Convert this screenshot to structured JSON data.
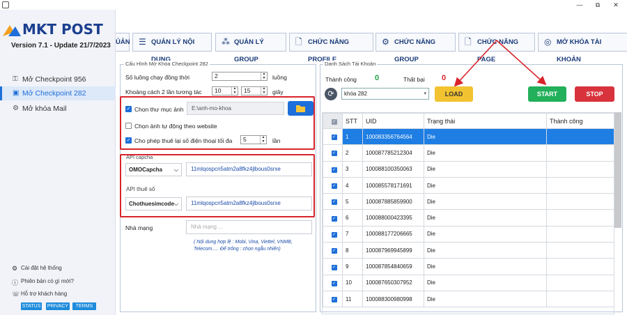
{
  "window": {
    "minimize": "—",
    "restore": "⧉",
    "close": "✕"
  },
  "brand": {
    "logo_text": "MKT POST",
    "version": "Version  7.1  - Update  21/7/2023"
  },
  "sidebar": {
    "items": [
      {
        "label": "Mở Checkpoint 956",
        "active": false
      },
      {
        "label": "Mở Checkpoint 282",
        "active": true
      },
      {
        "label": "Mở khóa Mail",
        "active": false
      }
    ],
    "bottom": [
      {
        "label": "Cài đặt hệ thống"
      },
      {
        "label": "Phiên bản có gì mới?"
      },
      {
        "label": "Hỗ trợ khách hàng"
      }
    ],
    "pills": [
      "STATUS",
      "PRIVACY",
      "TERMS"
    ]
  },
  "tabs": [
    {
      "label": "ỦẢN"
    },
    {
      "label": "QUẢN LÝ NỘI DUNG"
    },
    {
      "label": "QUẢN LÝ GROUP"
    },
    {
      "label": "CHỨC NĂNG PROFILE"
    },
    {
      "label": "CHỨC NĂNG GROUP"
    },
    {
      "label": "CHỨC NĂNG PAGE"
    },
    {
      "label": "MỞ KHÓA TÀI KHOẢN"
    }
  ],
  "config": {
    "legend": "Cấu Hình Mở Khóa Checkpoint 282",
    "threads_label": "Số luồng chạy đồng thời",
    "threads_value": "2",
    "threads_unit": "luồng",
    "interval_label": "Khoảng cách 2 lần tương tác",
    "interval_from": "10",
    "interval_to": "15",
    "interval_unit": "giây",
    "image_folder_label": "Chọn  thư mục ảnh",
    "image_folder_value": "E:\\anh-mo-khoa",
    "image_folder_checked": true,
    "auto_image_label": "Chọn ảnh tự động theo website",
    "auto_image_checked": false,
    "retry_label": "Cho phép thuê lại số điện thoại tối đa",
    "retry_value": "5",
    "retry_unit": "lần",
    "retry_checked": true,
    "captcha_legend": "API capcha",
    "captcha_provider": "OMOCapcha",
    "captcha_key": "11mlqospcn5atm2a8fkz4jlbous0srxe",
    "phone_legend": "API thuê số",
    "phone_provider": "Chothuesimcode",
    "phone_key": "11mlqospcn5atm2a8fkz4jlbous0srxe",
    "carrier_label": "Nhà mạng",
    "carrier_placeholder": "Nhà mạng ...",
    "carrier_hint": "( Nội dung hợp lệ : Mobi, Vina, Viettel, VNMB, Telecom.....  Để trống : chọn ngẫu nhiên)"
  },
  "accounts": {
    "legend": "Danh Sách Tài Khoản",
    "success_label": "Thành công",
    "success_count": "0",
    "fail_label": "Thất bại",
    "fail_count": "0",
    "selected_list": "khóa 282",
    "load_label": "LOAD",
    "start_label": "START",
    "stop_label": "STOP",
    "columns": [
      "STT",
      "UID",
      "Trạng thái",
      "Thành công"
    ],
    "rows": [
      {
        "stt": "1",
        "uid": "100083356764564",
        "status": "Die",
        "success": ""
      },
      {
        "stt": "2",
        "uid": "100087785212304",
        "status": "Die",
        "success": ""
      },
      {
        "stt": "3",
        "uid": "100088100350063",
        "status": "Die",
        "success": ""
      },
      {
        "stt": "4",
        "uid": "100085578171691",
        "status": "Die",
        "success": ""
      },
      {
        "stt": "5",
        "uid": "100087885859900",
        "status": "Die",
        "success": ""
      },
      {
        "stt": "6",
        "uid": "100088000423395",
        "status": "Die",
        "success": ""
      },
      {
        "stt": "7",
        "uid": "100088177206665",
        "status": "Die",
        "success": ""
      },
      {
        "stt": "8",
        "uid": "100087969945899",
        "status": "Die",
        "success": ""
      },
      {
        "stt": "9",
        "uid": "100087854840659",
        "status": "Die",
        "success": ""
      },
      {
        "stt": "10",
        "uid": "100087650307952",
        "status": "Die",
        "success": ""
      },
      {
        "stt": "11",
        "uid": "100088300980998",
        "status": "Die",
        "success": ""
      }
    ]
  },
  "colors": {
    "accent": "#1e6fd9",
    "highlight": "#d9232a",
    "load": "#f2c230",
    "start": "#22b05a",
    "stop": "#d8323c",
    "selected_row": "#1e7ee4"
  }
}
